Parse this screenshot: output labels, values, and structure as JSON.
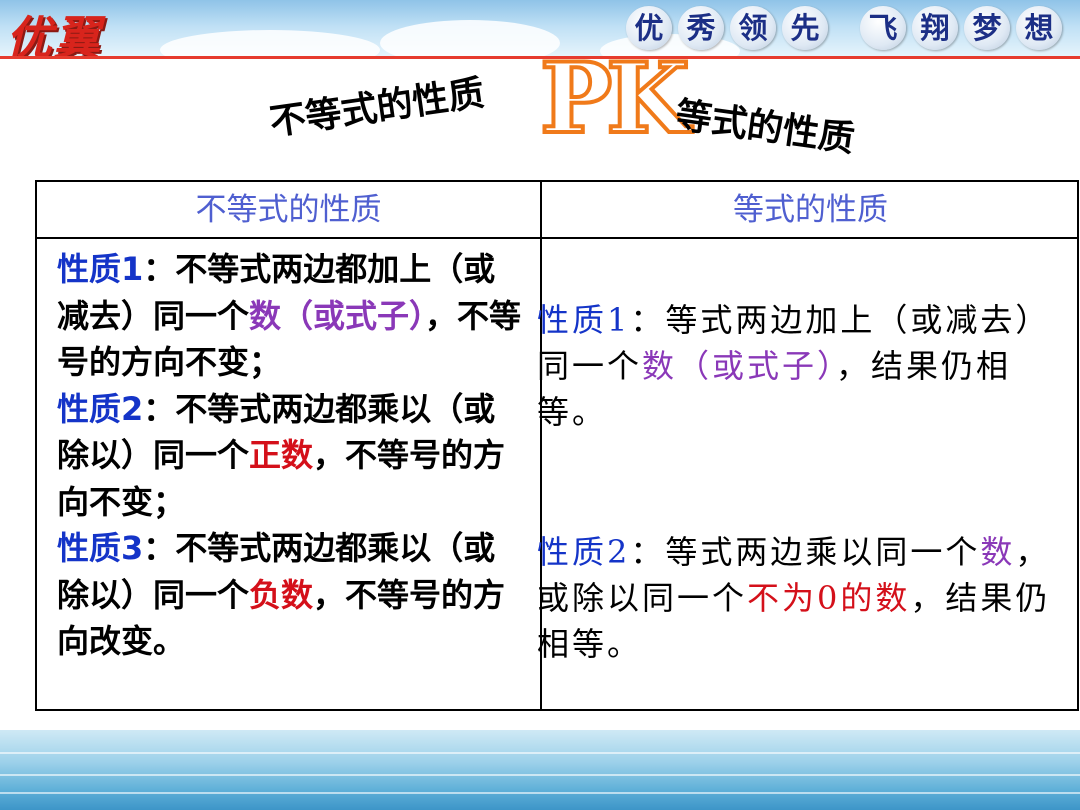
{
  "banner": {
    "logo": "优翼",
    "slogan": [
      "优",
      "秀",
      "领",
      "先",
      "飞",
      "翔",
      "梦",
      "想"
    ]
  },
  "title": {
    "left": "不等式的性质",
    "pk": "PK",
    "right": "等式的性质"
  },
  "table": {
    "header_left": "不等式的性质",
    "header_right": "等式的性质",
    "left": {
      "p1_label": "性质1",
      "p1_a": "：不等式两边都加上（或减去）同一个",
      "p1_hl": "数（或式子）",
      "p1_b": "，不等号的方向不变；",
      "p2_label": "性质2",
      "p2_a": "：不等式两边都乘以（或除以）同一个",
      "p2_hl": "正数",
      "p2_b": "，不等号的方向不变；",
      "p3_label": "性质3",
      "p3_a": "：不等式两边都乘以（或除以）同一个",
      "p3_hl": "负数",
      "p3_b": "，不等号的方向改变。"
    },
    "right": {
      "p1_label": "性质1",
      "p1_a": "：等式两边加上（或减去）同一个",
      "p1_hl": "数（或式子）",
      "p1_b": "，结果仍相等。",
      "p2_label": "性质2",
      "p2_a": "：等式两边乘以同一个",
      "p2_hl1": "数",
      "p2_b": "，或除以同一个",
      "p2_hl2": "不为0的数",
      "p2_c": "，结果仍相等。"
    }
  },
  "colors": {
    "property_label": "#1434c8",
    "expression_highlight": "#8a38b8",
    "number_highlight": "#d4101a",
    "header_text": "#4f5fd0",
    "pk_outline": "#f07a1a",
    "banner_line": "#e63b2e"
  }
}
